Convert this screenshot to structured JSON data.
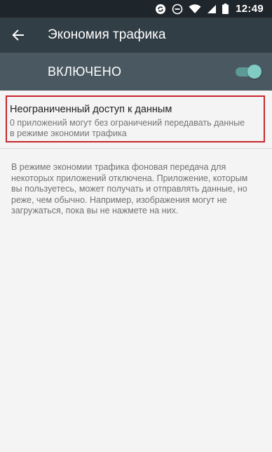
{
  "status_bar": {
    "time": "12:49",
    "icons": [
      "sync-icon",
      "do-not-disturb-icon",
      "wifi-icon",
      "signal-icon",
      "battery-icon"
    ]
  },
  "app_bar": {
    "back_icon": "arrow-back-icon",
    "title": "Экономия трафика"
  },
  "master_switch": {
    "label": "ВКЛЮЧЕНО",
    "checked": true,
    "accent_color": "#80cbc4"
  },
  "unrestricted_access": {
    "title": "Неограниченный доступ к данным",
    "summary": "0 приложений могут без ограничений передавать данные в режиме экономии трафика"
  },
  "footer": {
    "text": "В режиме экономии трафика фоновая передача для некоторых приложений отключена. Приложение, которым вы пользуетесь, может получать и отправлять данные, но реже, чем обычно. Например, изображения могут не загружаться, пока вы не нажмете на них."
  },
  "colors": {
    "status_bar": "#1f262b",
    "app_bar": "#323e46",
    "switch_bar": "#4a5861",
    "highlight_border": "#c8262e"
  }
}
